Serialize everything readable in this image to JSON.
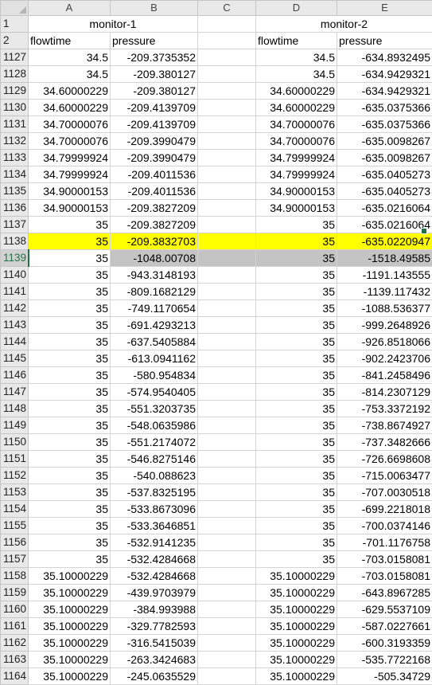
{
  "columns": [
    "",
    "A",
    "B",
    "C",
    "D",
    "E"
  ],
  "row1": {
    "num": "1",
    "monitor1": "monitor-1",
    "monitor2": "monitor-2"
  },
  "row2": {
    "num": "2",
    "a": "flowtime",
    "b": "pressure",
    "d": "flowtime",
    "e": "pressure"
  },
  "rows": [
    {
      "num": "1127",
      "a": "34.5",
      "b": "-209.3735352",
      "d": "34.5",
      "e": "-634.8932495"
    },
    {
      "num": "1128",
      "a": "34.5",
      "b": "-209.380127",
      "d": "34.5",
      "e": "-634.9429321"
    },
    {
      "num": "1129",
      "a": "34.60000229",
      "b": "-209.380127",
      "d": "34.60000229",
      "e": "-634.9429321"
    },
    {
      "num": "1130",
      "a": "34.60000229",
      "b": "-209.4139709",
      "d": "34.60000229",
      "e": "-635.0375366"
    },
    {
      "num": "1131",
      "a": "34.70000076",
      "b": "-209.4139709",
      "d": "34.70000076",
      "e": "-635.0375366"
    },
    {
      "num": "1132",
      "a": "34.70000076",
      "b": "-209.3990479",
      "d": "34.70000076",
      "e": "-635.0098267"
    },
    {
      "num": "1133",
      "a": "34.79999924",
      "b": "-209.3990479",
      "d": "34.79999924",
      "e": "-635.0098267"
    },
    {
      "num": "1134",
      "a": "34.79999924",
      "b": "-209.4011536",
      "d": "34.79999924",
      "e": "-635.0405273"
    },
    {
      "num": "1135",
      "a": "34.90000153",
      "b": "-209.4011536",
      "d": "34.90000153",
      "e": "-635.0405273"
    },
    {
      "num": "1136",
      "a": "34.90000153",
      "b": "-209.3827209",
      "d": "34.90000153",
      "e": "-635.0216064"
    },
    {
      "num": "1137",
      "a": "35",
      "b": "-209.3827209",
      "d": "35",
      "e": "-635.0216064"
    },
    {
      "num": "1138",
      "a": "35",
      "b": "-209.3832703",
      "d": "35",
      "e": "-635.0220947"
    },
    {
      "num": "1139",
      "a": "35",
      "b": "-1048.00708",
      "d": "35",
      "e": "-1518.49585"
    },
    {
      "num": "1140",
      "a": "35",
      "b": "-943.3148193",
      "d": "35",
      "e": "-1191.143555"
    },
    {
      "num": "1141",
      "a": "35",
      "b": "-809.1682129",
      "d": "35",
      "e": "-1139.117432"
    },
    {
      "num": "1142",
      "a": "35",
      "b": "-749.1170654",
      "d": "35",
      "e": "-1088.536377"
    },
    {
      "num": "1143",
      "a": "35",
      "b": "-691.4293213",
      "d": "35",
      "e": "-999.2648926"
    },
    {
      "num": "1144",
      "a": "35",
      "b": "-637.5405884",
      "d": "35",
      "e": "-926.8518066"
    },
    {
      "num": "1145",
      "a": "35",
      "b": "-613.0941162",
      "d": "35",
      "e": "-902.2423706"
    },
    {
      "num": "1146",
      "a": "35",
      "b": "-580.954834",
      "d": "35",
      "e": "-841.2458496"
    },
    {
      "num": "1147",
      "a": "35",
      "b": "-574.9540405",
      "d": "35",
      "e": "-814.2307129"
    },
    {
      "num": "1148",
      "a": "35",
      "b": "-551.3203735",
      "d": "35",
      "e": "-753.3372192"
    },
    {
      "num": "1149",
      "a": "35",
      "b": "-548.0635986",
      "d": "35",
      "e": "-738.8674927"
    },
    {
      "num": "1150",
      "a": "35",
      "b": "-551.2174072",
      "d": "35",
      "e": "-737.3482666"
    },
    {
      "num": "1151",
      "a": "35",
      "b": "-546.8275146",
      "d": "35",
      "e": "-726.6698608"
    },
    {
      "num": "1152",
      "a": "35",
      "b": "-540.088623",
      "d": "35",
      "e": "-715.0063477"
    },
    {
      "num": "1153",
      "a": "35",
      "b": "-537.8325195",
      "d": "35",
      "e": "-707.0030518"
    },
    {
      "num": "1154",
      "a": "35",
      "b": "-533.8673096",
      "d": "35",
      "e": "-699.2218018"
    },
    {
      "num": "1155",
      "a": "35",
      "b": "-533.3646851",
      "d": "35",
      "e": "-700.0374146"
    },
    {
      "num": "1156",
      "a": "35",
      "b": "-532.9141235",
      "d": "35",
      "e": "-701.1176758"
    },
    {
      "num": "1157",
      "a": "35",
      "b": "-532.4284668",
      "d": "35",
      "e": "-703.0158081"
    },
    {
      "num": "1158",
      "a": "35.10000229",
      "b": "-532.4284668",
      "d": "35.10000229",
      "e": "-703.0158081"
    },
    {
      "num": "1159",
      "a": "35.10000229",
      "b": "-439.9703979",
      "d": "35.10000229",
      "e": "-643.8967285"
    },
    {
      "num": "1160",
      "a": "35.10000229",
      "b": "-384.993988",
      "d": "35.10000229",
      "e": "-629.5537109"
    },
    {
      "num": "1161",
      "a": "35.10000229",
      "b": "-329.7782593",
      "d": "35.10000229",
      "e": "-587.0227661"
    },
    {
      "num": "1162",
      "a": "35.10000229",
      "b": "-316.5415039",
      "d": "35.10000229",
      "e": "-600.3193359"
    },
    {
      "num": "1163",
      "a": "35.10000229",
      "b": "-263.3424683",
      "d": "35.10000229",
      "e": "-535.7722168"
    },
    {
      "num": "1164",
      "a": "35.10000229",
      "b": "-245.0635529",
      "d": "35.10000229",
      "e": "-505.34729"
    }
  ],
  "highlight_row": "1138",
  "selected_row": "1139",
  "colors": {
    "highlight": "#ffff00",
    "selection": "#c4c4c4",
    "accent": "#217346"
  }
}
